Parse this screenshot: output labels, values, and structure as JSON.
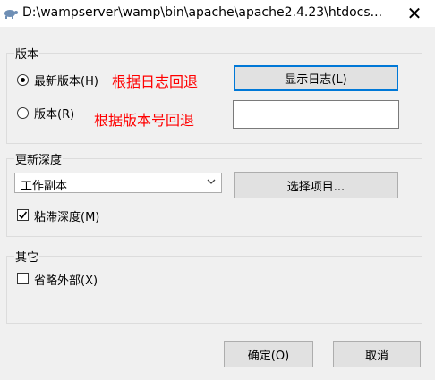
{
  "window": {
    "title": "D:\\wampserver\\wamp\\bin\\apache\\apache2.4.23\\htdocs...",
    "close_glyph": "✕"
  },
  "version_group": {
    "title": "版本",
    "newest_label": "最新版本(H)",
    "newest_annotation": "根据日志回退",
    "show_log_button": "显示日志(L)",
    "revision_label": "版本(R)",
    "revision_annotation": "根据版本号回退",
    "revision_value": ""
  },
  "depth_group": {
    "title": "更新深度",
    "depth_selected": "工作副本",
    "choose_items_button": "选择项目...",
    "sticky_depth_label": "粘滞深度(M)",
    "sticky_depth_checked": true
  },
  "other_group": {
    "title": "其它",
    "omit_externals_label": "省略外部(X)",
    "omit_externals_checked": false
  },
  "footer": {
    "ok_button": "确定(O)",
    "cancel_button": "取消"
  },
  "colors": {
    "annotation": "#ff0000",
    "default_button_border": "#0078d7"
  }
}
